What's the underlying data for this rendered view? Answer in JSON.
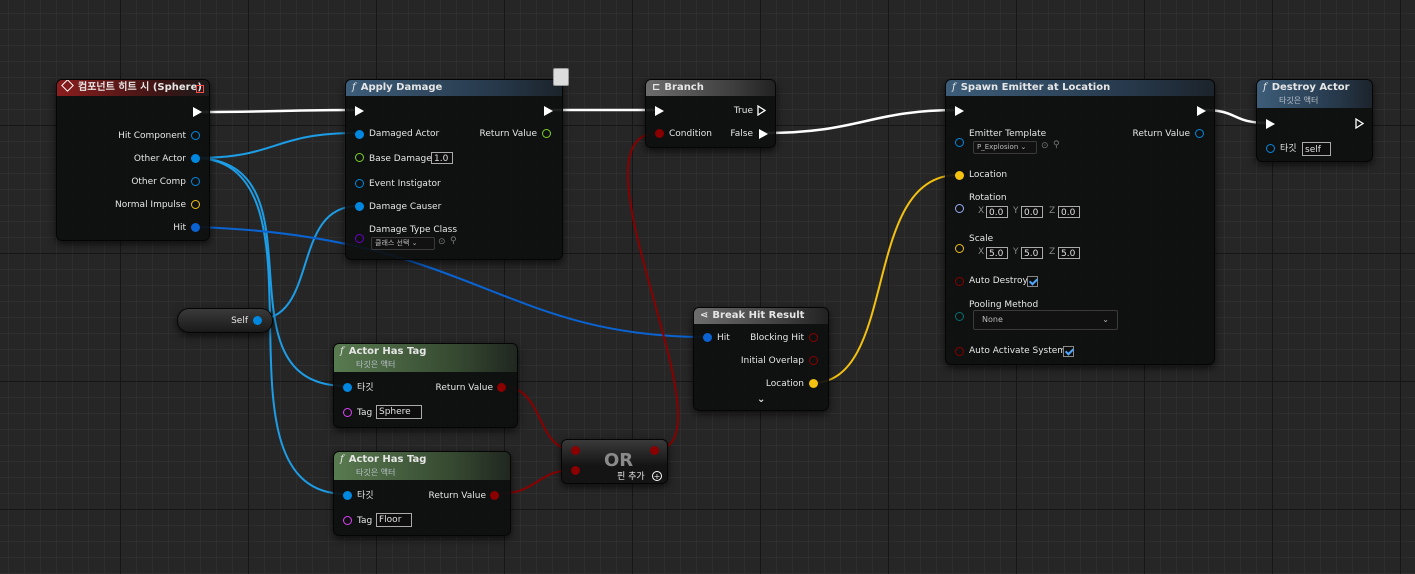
{
  "colors": {
    "exec": "#ffffff",
    "object": "#0088e0",
    "bool": "#8a0000",
    "float": "#7cd320",
    "vector": "#f3c110",
    "rotator": "#9aaef7",
    "class": "#6a00c8",
    "string": "#e040fb",
    "enum": "#0a6e6e",
    "struct": "#0a6ed8"
  },
  "event": {
    "title": "컴포넌트 히트 시 (Sphere)",
    "pins": {
      "hit_component": "Hit Component",
      "other_actor": "Other Actor",
      "other_comp": "Other Comp",
      "normal_impulse": "Normal Impulse",
      "hit": "Hit"
    }
  },
  "self_node": {
    "label": "Self"
  },
  "apply_damage": {
    "title": "Apply Damage",
    "damaged_actor": "Damaged Actor",
    "base_damage": "Base Damage",
    "base_damage_value": "1.0",
    "event_instigator": "Event Instigator",
    "damage_causer": "Damage Causer",
    "damage_type_class": "Damage Type Class",
    "class_select": "클래스 선택",
    "return_value": "Return Value"
  },
  "branch": {
    "title": "Branch",
    "condition": "Condition",
    "true": "True",
    "false": "False"
  },
  "spawn": {
    "title": "Spawn Emitter at Location",
    "emitter_template": "Emitter Template",
    "emitter_value": "P_Explosion",
    "return_value": "Return Value",
    "location": "Location",
    "rotation": "Rotation",
    "rot": {
      "x": "0.0",
      "y": "0.0",
      "z": "0.0"
    },
    "scale": "Scale",
    "sc": {
      "x": "5.0",
      "y": "5.0",
      "z": "5.0"
    },
    "auto_destroy": "Auto Destroy",
    "pooling_method": "Pooling Method",
    "pooling_value": "None",
    "auto_activate": "Auto Activate System",
    "axis": {
      "x": "X",
      "y": "Y",
      "z": "Z"
    }
  },
  "destroy": {
    "title": "Destroy Actor",
    "subtitle": "타깃은 액터",
    "target": "타깃",
    "target_value": "self"
  },
  "tag1": {
    "title": "Actor Has Tag",
    "subtitle": "타깃은 액터",
    "target": "타깃",
    "return_value": "Return Value",
    "tag": "Tag",
    "tag_value": "Sphere"
  },
  "tag2": {
    "title": "Actor Has Tag",
    "subtitle": "타깃은 액터",
    "target": "타깃",
    "return_value": "Return Value",
    "tag": "Tag",
    "tag_value": "Floor"
  },
  "or_node": {
    "label": "OR",
    "add_pin": "핀 추가"
  },
  "break_hit": {
    "title": "Break Hit Result",
    "hit": "Hit",
    "blocking_hit": "Blocking Hit",
    "initial_overlap": "Initial Overlap",
    "location": "Location"
  }
}
